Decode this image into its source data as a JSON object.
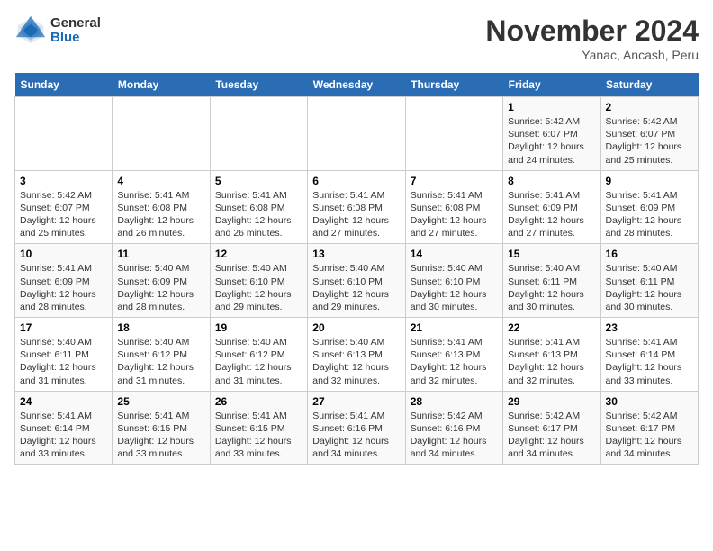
{
  "header": {
    "logo_general": "General",
    "logo_blue": "Blue",
    "month_title": "November 2024",
    "location": "Yanac, Ancash, Peru"
  },
  "weekdays": [
    "Sunday",
    "Monday",
    "Tuesday",
    "Wednesday",
    "Thursday",
    "Friday",
    "Saturday"
  ],
  "weeks": [
    [
      {
        "day": "",
        "content": ""
      },
      {
        "day": "",
        "content": ""
      },
      {
        "day": "",
        "content": ""
      },
      {
        "day": "",
        "content": ""
      },
      {
        "day": "",
        "content": ""
      },
      {
        "day": "1",
        "content": "Sunrise: 5:42 AM\nSunset: 6:07 PM\nDaylight: 12 hours and 24 minutes."
      },
      {
        "day": "2",
        "content": "Sunrise: 5:42 AM\nSunset: 6:07 PM\nDaylight: 12 hours and 25 minutes."
      }
    ],
    [
      {
        "day": "3",
        "content": "Sunrise: 5:42 AM\nSunset: 6:07 PM\nDaylight: 12 hours and 25 minutes."
      },
      {
        "day": "4",
        "content": "Sunrise: 5:41 AM\nSunset: 6:08 PM\nDaylight: 12 hours and 26 minutes."
      },
      {
        "day": "5",
        "content": "Sunrise: 5:41 AM\nSunset: 6:08 PM\nDaylight: 12 hours and 26 minutes."
      },
      {
        "day": "6",
        "content": "Sunrise: 5:41 AM\nSunset: 6:08 PM\nDaylight: 12 hours and 27 minutes."
      },
      {
        "day": "7",
        "content": "Sunrise: 5:41 AM\nSunset: 6:08 PM\nDaylight: 12 hours and 27 minutes."
      },
      {
        "day": "8",
        "content": "Sunrise: 5:41 AM\nSunset: 6:09 PM\nDaylight: 12 hours and 27 minutes."
      },
      {
        "day": "9",
        "content": "Sunrise: 5:41 AM\nSunset: 6:09 PM\nDaylight: 12 hours and 28 minutes."
      }
    ],
    [
      {
        "day": "10",
        "content": "Sunrise: 5:41 AM\nSunset: 6:09 PM\nDaylight: 12 hours and 28 minutes."
      },
      {
        "day": "11",
        "content": "Sunrise: 5:40 AM\nSunset: 6:09 PM\nDaylight: 12 hours and 28 minutes."
      },
      {
        "day": "12",
        "content": "Sunrise: 5:40 AM\nSunset: 6:10 PM\nDaylight: 12 hours and 29 minutes."
      },
      {
        "day": "13",
        "content": "Sunrise: 5:40 AM\nSunset: 6:10 PM\nDaylight: 12 hours and 29 minutes."
      },
      {
        "day": "14",
        "content": "Sunrise: 5:40 AM\nSunset: 6:10 PM\nDaylight: 12 hours and 30 minutes."
      },
      {
        "day": "15",
        "content": "Sunrise: 5:40 AM\nSunset: 6:11 PM\nDaylight: 12 hours and 30 minutes."
      },
      {
        "day": "16",
        "content": "Sunrise: 5:40 AM\nSunset: 6:11 PM\nDaylight: 12 hours and 30 minutes."
      }
    ],
    [
      {
        "day": "17",
        "content": "Sunrise: 5:40 AM\nSunset: 6:11 PM\nDaylight: 12 hours and 31 minutes."
      },
      {
        "day": "18",
        "content": "Sunrise: 5:40 AM\nSunset: 6:12 PM\nDaylight: 12 hours and 31 minutes."
      },
      {
        "day": "19",
        "content": "Sunrise: 5:40 AM\nSunset: 6:12 PM\nDaylight: 12 hours and 31 minutes."
      },
      {
        "day": "20",
        "content": "Sunrise: 5:40 AM\nSunset: 6:13 PM\nDaylight: 12 hours and 32 minutes."
      },
      {
        "day": "21",
        "content": "Sunrise: 5:41 AM\nSunset: 6:13 PM\nDaylight: 12 hours and 32 minutes."
      },
      {
        "day": "22",
        "content": "Sunrise: 5:41 AM\nSunset: 6:13 PM\nDaylight: 12 hours and 32 minutes."
      },
      {
        "day": "23",
        "content": "Sunrise: 5:41 AM\nSunset: 6:14 PM\nDaylight: 12 hours and 33 minutes."
      }
    ],
    [
      {
        "day": "24",
        "content": "Sunrise: 5:41 AM\nSunset: 6:14 PM\nDaylight: 12 hours and 33 minutes."
      },
      {
        "day": "25",
        "content": "Sunrise: 5:41 AM\nSunset: 6:15 PM\nDaylight: 12 hours and 33 minutes."
      },
      {
        "day": "26",
        "content": "Sunrise: 5:41 AM\nSunset: 6:15 PM\nDaylight: 12 hours and 33 minutes."
      },
      {
        "day": "27",
        "content": "Sunrise: 5:41 AM\nSunset: 6:16 PM\nDaylight: 12 hours and 34 minutes."
      },
      {
        "day": "28",
        "content": "Sunrise: 5:42 AM\nSunset: 6:16 PM\nDaylight: 12 hours and 34 minutes."
      },
      {
        "day": "29",
        "content": "Sunrise: 5:42 AM\nSunset: 6:17 PM\nDaylight: 12 hours and 34 minutes."
      },
      {
        "day": "30",
        "content": "Sunrise: 5:42 AM\nSunset: 6:17 PM\nDaylight: 12 hours and 34 minutes."
      }
    ]
  ]
}
